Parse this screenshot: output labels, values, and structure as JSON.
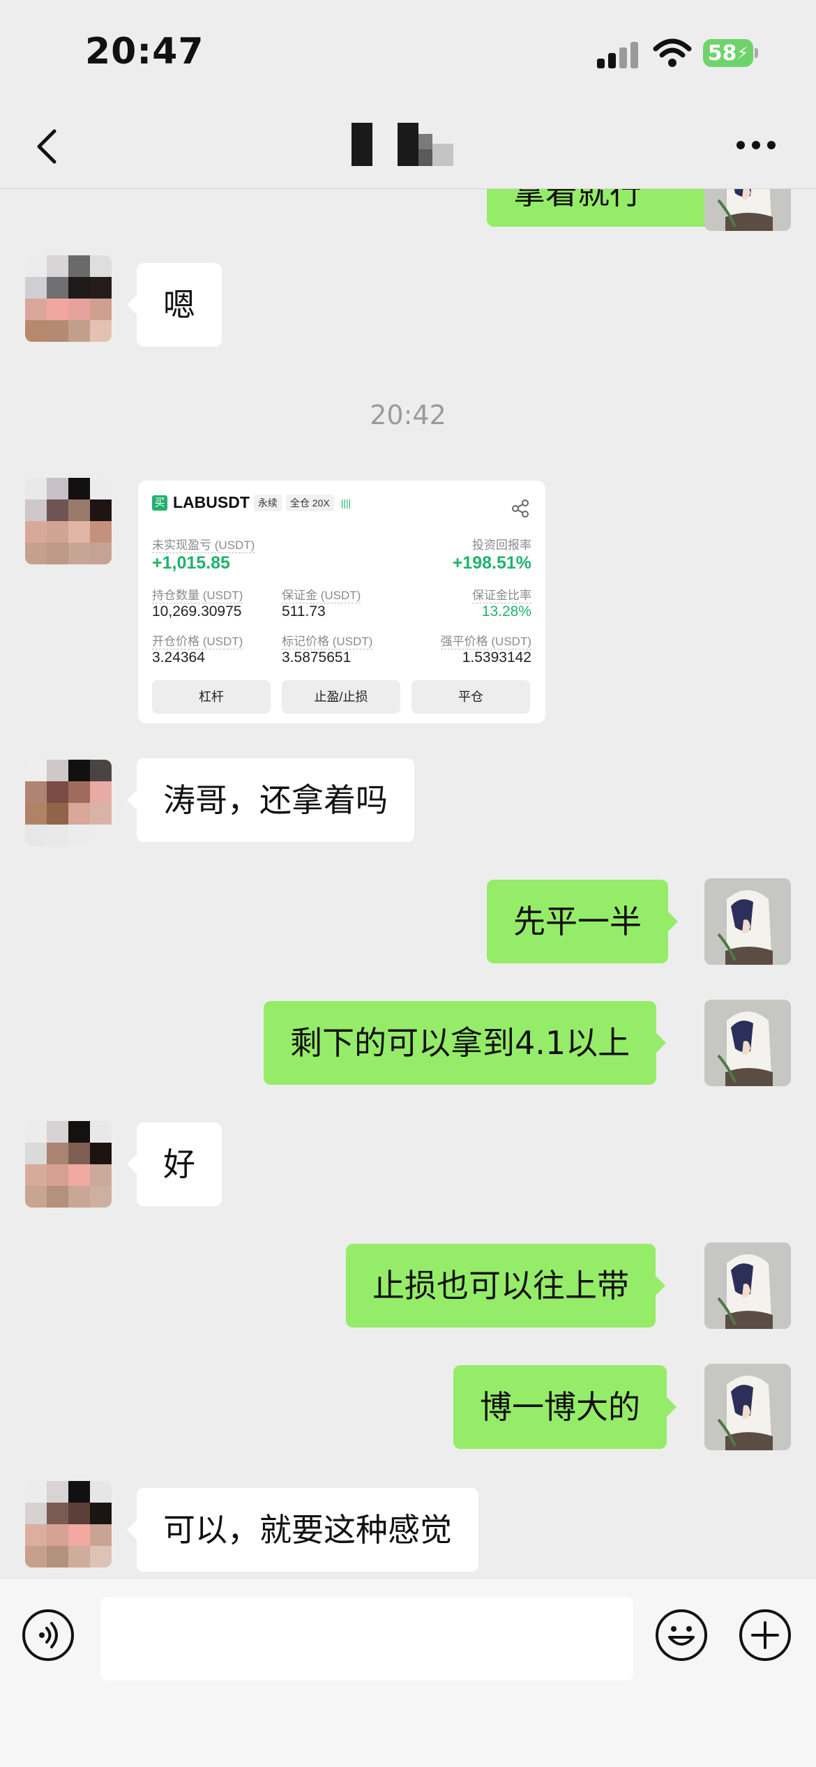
{
  "status_bar": {
    "time": "20:47",
    "battery_level": "58",
    "icons": [
      "signal-icon",
      "wifi-icon",
      "battery-charging-icon"
    ]
  },
  "nav": {
    "title": "",
    "icons": [
      "back-chevron-icon",
      "more-dots-icon"
    ]
  },
  "messages": [
    {
      "side": "right",
      "text": "拿着就行",
      "clipped": true
    },
    {
      "side": "left",
      "text": "嗯"
    },
    {
      "type": "timestamp",
      "text": "20:42"
    },
    {
      "side": "left",
      "type": "card",
      "card": {
        "side_label": "买",
        "symbol": "LABUSDT",
        "contract_type": "永续",
        "margin_mode": "全仓 20X",
        "signal_marks": "||||",
        "unrealized_pnl_label": "未实现盈亏 (USDT)",
        "unrealized_pnl_value": "+1,015.85",
        "roi_label": "投资回报率",
        "roi_value": "+198.51%",
        "position_size_label": "持仓数量 (USDT)",
        "position_size_value": "10,269.30975",
        "margin_label": "保证金 (USDT)",
        "margin_value": "511.73",
        "margin_ratio_label": "保证金比率",
        "margin_ratio_value": "13.28%",
        "entry_price_label": "开仓价格 (USDT)",
        "entry_price_value": "3.24364",
        "mark_price_label": "标记价格 (USDT)",
        "mark_price_value": "3.5875651",
        "liq_price_label": "强平价格 (USDT)",
        "liq_price_value": "1.5393142",
        "buttons": [
          "杠杆",
          "止盈/止损",
          "平仓"
        ]
      }
    },
    {
      "side": "left",
      "text": "涛哥，还拿着吗"
    },
    {
      "side": "right",
      "text": "先平一半"
    },
    {
      "side": "right",
      "text": "剩下的可以拿到4.1以上"
    },
    {
      "side": "left",
      "text": "好"
    },
    {
      "side": "right",
      "text": "止损也可以往上带"
    },
    {
      "side": "right",
      "text": "博一博大的"
    },
    {
      "side": "left",
      "text": "可以，就要这种感觉"
    }
  ],
  "input_bar": {
    "value": "",
    "icons": [
      "voice-icon",
      "emoji-icon",
      "plus-icon"
    ]
  },
  "colors": {
    "background": "#ededed",
    "sent_bubble": "#95ec69",
    "received_bubble": "#ffffff",
    "pnl_green": "#20b26c",
    "battery_green": "#6fd36b"
  }
}
